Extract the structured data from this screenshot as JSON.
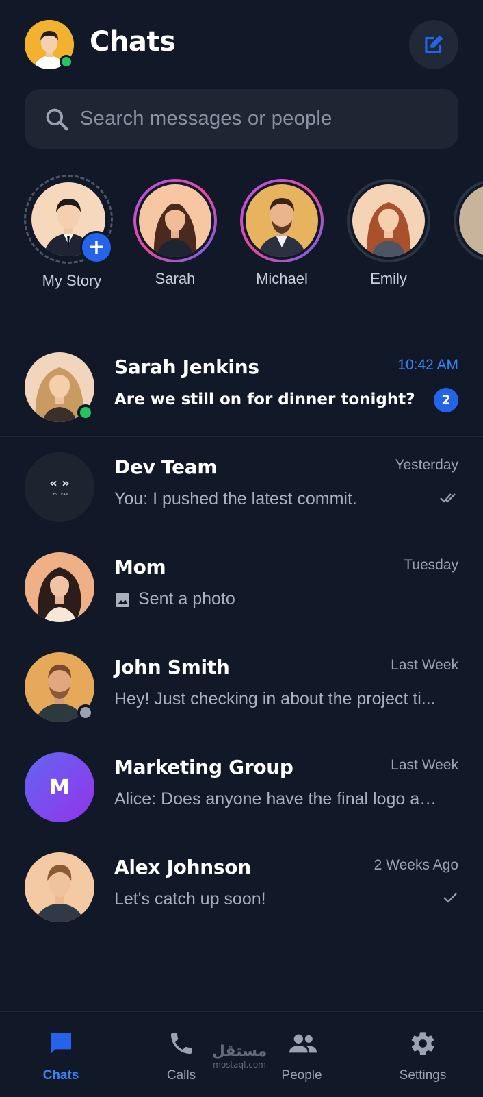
{
  "header": {
    "title": "Chats",
    "me": {
      "online": true
    }
  },
  "search": {
    "placeholder": "Search messages or people"
  },
  "stories": [
    {
      "name": "My Story",
      "add": true
    },
    {
      "name": "Sarah"
    },
    {
      "name": "Michael"
    },
    {
      "name": "Emily"
    }
  ],
  "chats": [
    {
      "name": "Sarah Jenkins",
      "time": "10:42 AM",
      "preview": "Are we still on for dinner tonight?",
      "unread": "2",
      "status": "online"
    },
    {
      "name": "Dev Team",
      "time": "Yesterday",
      "preview": "You: I pushed the latest commit.",
      "receipt": "double-check",
      "avatar_text": "DEV TEAM"
    },
    {
      "name": "Mom",
      "time": "Tuesday",
      "preview": "Sent a photo",
      "preview_icon": "image-icon"
    },
    {
      "name": "John Smith",
      "time": "Last Week",
      "preview": "Hey! Just checking in about the project ti...",
      "status": "away"
    },
    {
      "name": "Marketing Group",
      "time": "Last Week",
      "preview": "Alice: Does anyone have the final logo ass...",
      "avatar_initial": "M"
    },
    {
      "name": "Alex Johnson",
      "time": "2 Weeks Ago",
      "preview": "Let's catch up soon!",
      "receipt": "single-check"
    }
  ],
  "nav": [
    {
      "label": "Chats",
      "icon": "chat-bubble-icon",
      "active": true
    },
    {
      "label": "Calls",
      "icon": "phone-icon"
    },
    {
      "label": "People",
      "icon": "people-icon"
    },
    {
      "label": "Settings",
      "icon": "gear-icon"
    }
  ],
  "watermark": {
    "arabic": "مستقل",
    "latin": "mostaql.com"
  },
  "colors": {
    "background": "#111827",
    "accent": "#2563eb",
    "online": "#22c55e",
    "away": "#9ca3af"
  }
}
